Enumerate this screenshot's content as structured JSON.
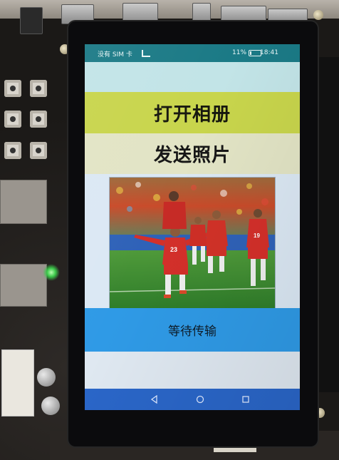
{
  "status_bar": {
    "carrier": "没有 SIM 卡",
    "battery": "11%",
    "time": "18:41"
  },
  "buttons": {
    "open_album": "打开相册",
    "send_photo": "发送照片"
  },
  "transfer_status": "等待传输",
  "photo": {
    "jersey_numbers": [
      "23",
      "19"
    ]
  },
  "icons": {
    "signal": "signal-icon",
    "battery": "battery-icon",
    "back": "nav-back-icon",
    "home": "nav-home-icon",
    "recent": "nav-recent-icon"
  },
  "colors": {
    "status_bar": "#1b7a86",
    "open_button": "#c8d54c",
    "send_button": "#e2e4c5",
    "status_panel": "#2f9ae6",
    "nav_bar": "#2a66c8"
  }
}
